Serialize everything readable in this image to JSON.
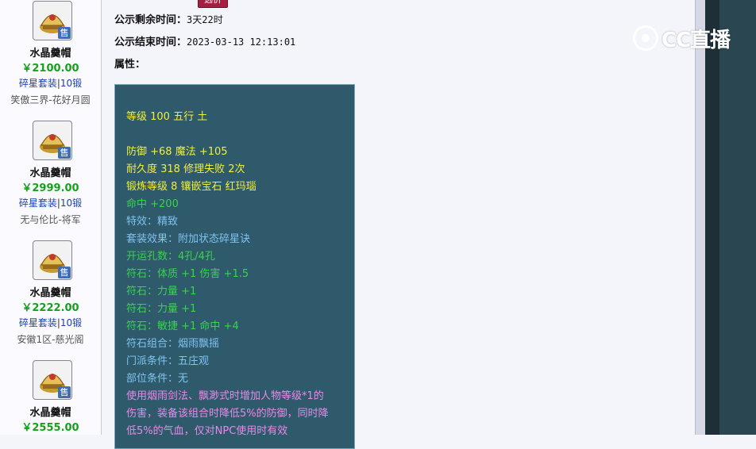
{
  "left_list": {
    "items": [
      {
        "name": "水晶羹帽",
        "price": "￥2100.00",
        "set": "碎星套装",
        "forge": "10锻",
        "seller": "笑傲三界-花好月圆",
        "badge": "售"
      },
      {
        "name": "水晶羹帽",
        "price": "￥2999.00",
        "set": "碎星套装",
        "forge": "10锻",
        "seller": "无与伦比-将军",
        "badge": "售"
      },
      {
        "name": "水晶羹帽",
        "price": "￥2222.00",
        "set": "碎星套装",
        "forge": "10锻",
        "seller": "安徽1区-慈光阁",
        "badge": "售"
      },
      {
        "name": "水晶羹帽",
        "price": "￥2555.00",
        "set": "",
        "forge": "",
        "seller": "",
        "badge": "售"
      }
    ]
  },
  "detail": {
    "top_button_label": "选价",
    "remaining_label": "公示剩余时间：",
    "remaining_value": "3天22时",
    "end_label": "公示结束时间：",
    "end_value": "2023-03-13 12:13:01",
    "attributes_label": "属性：",
    "panel_lines": [
      {
        "text": "等级 100 五行 土",
        "color": "yellow"
      },
      {
        "text": "",
        "color": "gap"
      },
      {
        "text": "防御 +68 魔法 +105",
        "color": "yellow"
      },
      {
        "text": "耐久度 318 修理失败 2次",
        "color": "yellow"
      },
      {
        "text": "锻炼等级 8 镶嵌宝石 红玛瑙",
        "color": "yellow"
      },
      {
        "text": "命中 +200",
        "color": "green"
      },
      {
        "text": "特效：精致",
        "color": "blue"
      },
      {
        "text": "套装效果：附加状态碎星诀",
        "color": "blue"
      },
      {
        "text": "开运孔数：4孔/4孔",
        "color": "green"
      },
      {
        "text": "符石：体质 +1 伤害 +1.5",
        "color": "green"
      },
      {
        "text": "符石：力量 +1",
        "color": "green"
      },
      {
        "text": "符石：力量 +1",
        "color": "green"
      },
      {
        "text": "符石：敏捷 +1 命中 +4",
        "color": "green"
      },
      {
        "text": "符石组合：烟雨飘摇",
        "color": "blue"
      },
      {
        "text": "门派条件：五庄观",
        "color": "blue"
      },
      {
        "text": "部位条件：无",
        "color": "blue"
      },
      {
        "text": "使用烟雨剑法、飘渺式时增加人物等级*1的",
        "color": "pink"
      },
      {
        "text": "伤害，装备该组合时降低5%的防御，同时降",
        "color": "pink"
      },
      {
        "text": "低5%的气血，仅对NPC使用时有效",
        "color": "pink"
      }
    ]
  },
  "watermark": {
    "brand": "CC直播",
    "icon": "cc-eye-icon"
  },
  "colors": {
    "panel_bg": "#2f5a6b",
    "price": "#15a21a",
    "yellow": "#f1ee3c",
    "green": "#33d64a",
    "blue": "#7fc3f0",
    "pink": "#e889e8"
  }
}
